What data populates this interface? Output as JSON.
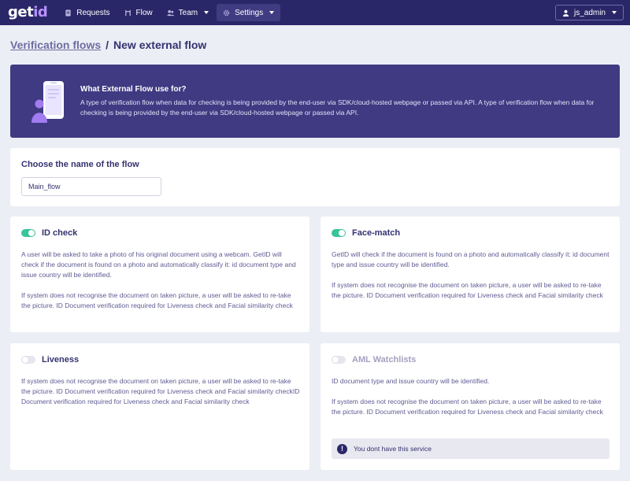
{
  "navbar": {
    "logo_main": "get",
    "logo_accent": "id",
    "items": [
      {
        "label": "Requests",
        "icon": "document-icon"
      },
      {
        "label": "Flow",
        "icon": "flow-icon"
      },
      {
        "label": "Team",
        "icon": "team-icon"
      },
      {
        "label": "Settings",
        "icon": "gear-icon"
      }
    ],
    "user": "js_admin"
  },
  "breadcrumb": {
    "parent": "Verification flows",
    "separator": "/",
    "current": "New external flow"
  },
  "banner": {
    "title": "What External Flow use for?",
    "text": "A type of verification flow when data for checking is being provided by the end-user via SDK/cloud-hosted webpage or passed via API. A type of verification flow when data for checking is being provided by the end-user via SDK/cloud-hosted webpage or passed via API."
  },
  "name_section": {
    "label": "Choose the name of the flow",
    "value": "Main_flow"
  },
  "features": {
    "id_check": {
      "title": "ID check",
      "enabled": true,
      "p1": "A user will be asked to take a photo of his original document using a webcam. GetID will check if the document is found on a photo and automatically classify it: id document type and issue country will be identified.",
      "p2": "If system does not recognise the document on taken picture, a user will be asked to re-take the picture. ID Document verification required for Liveness check and Facial similarity check"
    },
    "face_match": {
      "title": "Face-match",
      "enabled": true,
      "p1": "GetID will check if the document is found on a photo and automatically classify it: id document type and issue country will be identified.",
      "p2": "If system does not recognise the document on taken picture, a user will be asked to re-take the picture. ID Document verification required for Liveness check and Facial similarity check"
    },
    "liveness": {
      "title": "Liveness",
      "enabled": false,
      "p1": "If system does not recognise the document on taken picture, a user will be asked to re-take the picture. ID Document verification required for Liveness check and Facial similarity checkID Document verification required for Liveness check and Facial similarity check"
    },
    "aml": {
      "title": "AML Watchlists",
      "enabled": false,
      "p1": "ID document type and issue country will be identified.",
      "p2": "If system does not recognise the document on taken picture, a user will be asked to re-take the picture. ID Document verification required for Liveness check and Facial similarity check",
      "alert": "You dont have this service"
    }
  },
  "colors": {
    "navbar": "#2a2768",
    "banner": "#3f3a82",
    "toggle_on": "#38c49a",
    "accent": "#b892ff"
  }
}
